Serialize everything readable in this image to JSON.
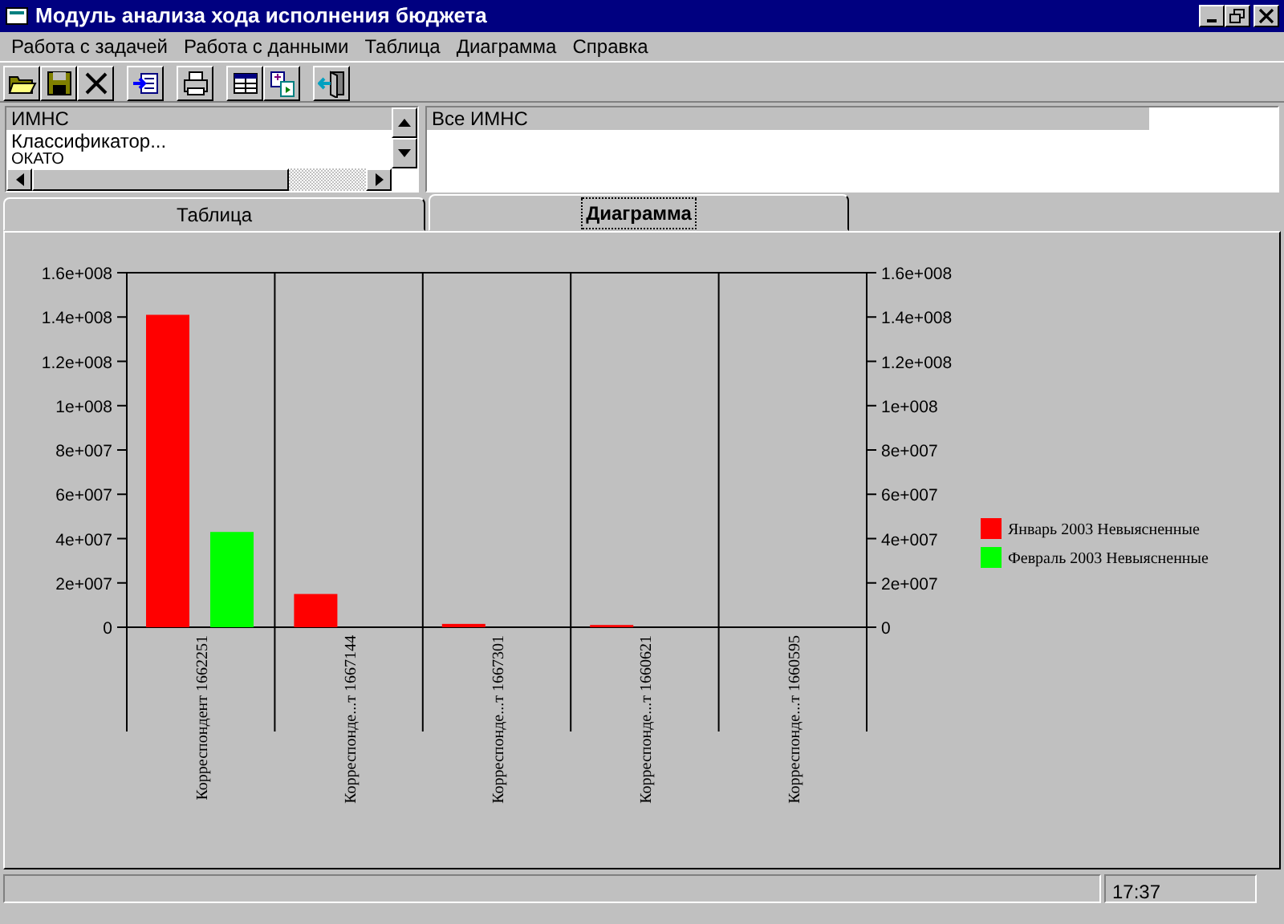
{
  "window": {
    "title": "Модуль анализа хода исполнения бюджета"
  },
  "menu": [
    "Работа с задачей",
    "Работа с данными",
    "Таблица",
    "Диаграмма",
    "Справка"
  ],
  "filter_list": [
    {
      "label": "ИМНС",
      "selected": true
    },
    {
      "label": "Классификатор...",
      "selected": false
    },
    {
      "label": "ОКАТО",
      "selected": false
    }
  ],
  "value_list": [
    {
      "label": "Все ИМНС",
      "selected": true
    }
  ],
  "tabs": [
    {
      "label": "Таблица",
      "selected": false
    },
    {
      "label": "Диаграмма",
      "selected": true
    }
  ],
  "chart": {
    "chart_data": {
      "type": "bar",
      "categories": [
        "Корреспондент 1662251",
        "Корреспонде...т 1667144",
        "Корреспонде...т 1667301",
        "Корреспонде...т 1660621",
        "Корреспонде...т 1660595"
      ],
      "series": [
        {
          "name": "Январь 2003 Невыясненные",
          "color": "#ff0000",
          "values": [
            141000000,
            15000000,
            1500000,
            1000000,
            0
          ]
        },
        {
          "name": "Февраль 2003 Невыясненные",
          "color": "#00ff00",
          "values": [
            43000000,
            0,
            0,
            0,
            0
          ]
        }
      ],
      "ylim": [
        0,
        160000000
      ],
      "legend": "right",
      "yticks": [
        {
          "value": 0,
          "label": "0"
        },
        {
          "value": 20000000,
          "label": "2e+007"
        },
        {
          "value": 40000000,
          "label": "4e+007"
        },
        {
          "value": 60000000,
          "label": "6e+007"
        },
        {
          "value": 80000000,
          "label": "8e+007"
        },
        {
          "value": 100000000,
          "label": "1e+008"
        },
        {
          "value": 120000000,
          "label": "1.2e+008"
        },
        {
          "value": 140000000,
          "label": "1.4e+008"
        },
        {
          "value": 160000000,
          "label": "1.6e+008"
        }
      ]
    }
  },
  "status_bar": {
    "time": "17:37"
  }
}
